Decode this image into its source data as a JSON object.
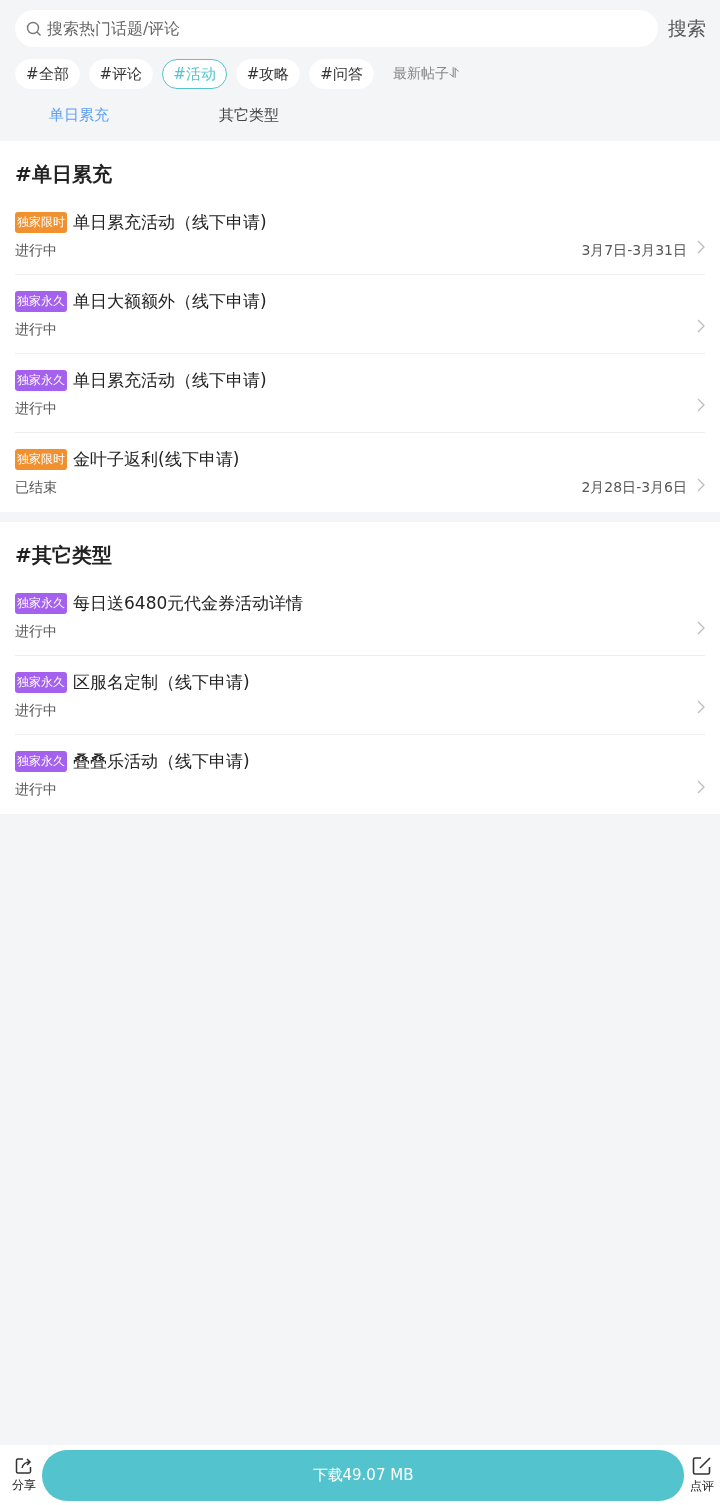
{
  "search": {
    "placeholder": "搜索热门话题/评论",
    "button": "搜索"
  },
  "filters": [
    {
      "label": "#全部",
      "selected": false
    },
    {
      "label": "#评论",
      "selected": false
    },
    {
      "label": "#活动",
      "selected": true
    },
    {
      "label": "#攻略",
      "selected": false
    },
    {
      "label": "#问答",
      "selected": false
    }
  ],
  "sort": {
    "label": "最新帖子⥯"
  },
  "subtabs": [
    {
      "label": "单日累充",
      "selected": true
    },
    {
      "label": "其它类型",
      "selected": false
    }
  ],
  "sections": [
    {
      "title": "#单日累充",
      "items": [
        {
          "badge": "独家限时",
          "color": "#f0902e",
          "title": "单日累充活动（线下申请)",
          "status": "进行中",
          "date": "3月7日-3月31日"
        },
        {
          "badge": "独家永久",
          "color": "#a461ee",
          "title": "单日大额额外（线下申请)",
          "status": "进行中"
        },
        {
          "badge": "独家永久",
          "color": "#a461ee",
          "title": "单日累充活动（线下申请)",
          "status": "进行中"
        },
        {
          "badge": "独家限时",
          "color": "#f0902e",
          "title": "金叶子返利(线下申请)",
          "status": "已结束",
          "date": "2月28日-3月6日"
        }
      ]
    },
    {
      "title": "#其它类型",
      "items": [
        {
          "badge": "独家永久",
          "color": "#a461ee",
          "title": "每日送6480元代金券活动详情",
          "status": "进行中"
        },
        {
          "badge": "独家永久",
          "color": "#a461ee",
          "title": "区服名定制（线下申请)",
          "status": "进行中"
        },
        {
          "badge": "独家永久",
          "color": "#a461ee",
          "title": "叠叠乐活动（线下申请)",
          "status": "进行中"
        }
      ]
    }
  ],
  "bottom_bar": {
    "share": "分享",
    "download": "下载49.07 MB",
    "review": "点评"
  }
}
